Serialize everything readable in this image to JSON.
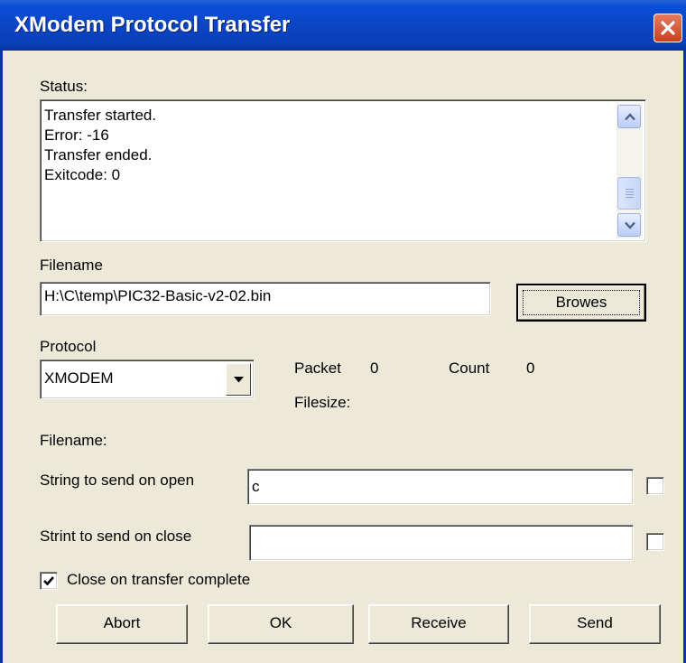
{
  "window": {
    "title": "XModem Protocol Transfer"
  },
  "status": {
    "label": "Status:",
    "lines": [
      "Transfer started.",
      "Error: -16",
      "Transfer ended.",
      "Exitcode: 0"
    ]
  },
  "file": {
    "label": "Filename",
    "value": "H:\\C\\temp\\PIC32-Basic-v2-02.bin",
    "browse_label": "Browes"
  },
  "protocol": {
    "label": "Protocol",
    "selected": "XMODEM"
  },
  "stats": {
    "packet_label": "Packet",
    "packet_value": "0",
    "count_label": "Count",
    "count_value": "0",
    "filesize_label": "Filesize:"
  },
  "filename2_label": "Filename:",
  "open_string": {
    "label": "String to send on open",
    "value": "c",
    "checked": false
  },
  "close_string": {
    "label": "Strint to send on close",
    "value": "",
    "checked": false
  },
  "close_on_complete": {
    "label": "Close on transfer complete",
    "checked": true
  },
  "buttons": {
    "abort": "Abort",
    "ok": "OK",
    "receive": "Receive",
    "send": "Send"
  },
  "colors": {
    "titlebar": "#0a4fd8",
    "dialog_bg": "#ece9d8",
    "close_button": "#d9542f"
  },
  "icons": {
    "close": "close-icon",
    "scroll_up": "chevron-up-icon",
    "scroll_down": "chevron-down-icon",
    "dropdown": "triangle-down-icon",
    "check": "check-icon"
  }
}
